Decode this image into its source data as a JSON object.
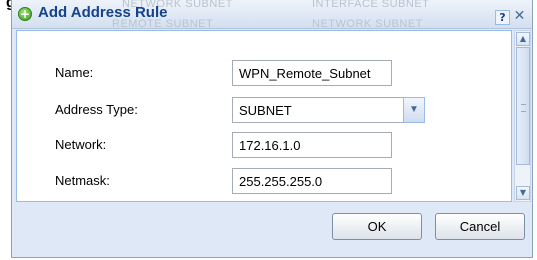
{
  "document": {
    "caption_fragment": "g"
  },
  "background_ghost": {
    "top_left": "NETWORK SUBNET",
    "top_right": "INTERFACE SUBNET",
    "second_left": "REMOTE SUBNET",
    "second_right": "NETWORK SUBNET"
  },
  "dialog": {
    "title": "Add Address Rule",
    "title_icon": "add-icon",
    "help_label": "?",
    "close_label": "✕"
  },
  "form": {
    "name_label": "Name:",
    "name_value": "WPN_Remote_Subnet",
    "type_label": "Address Type:",
    "type_value": "SUBNET",
    "network_label": "Network:",
    "network_value": "172.16.1.0",
    "netmask_label": "Netmask:",
    "netmask_value": "255.255.255.0"
  },
  "buttons": {
    "ok": "OK",
    "cancel": "Cancel"
  },
  "colors": {
    "title": "#15428b",
    "border": "#99bbe8",
    "panel": "#dfe8f6"
  }
}
